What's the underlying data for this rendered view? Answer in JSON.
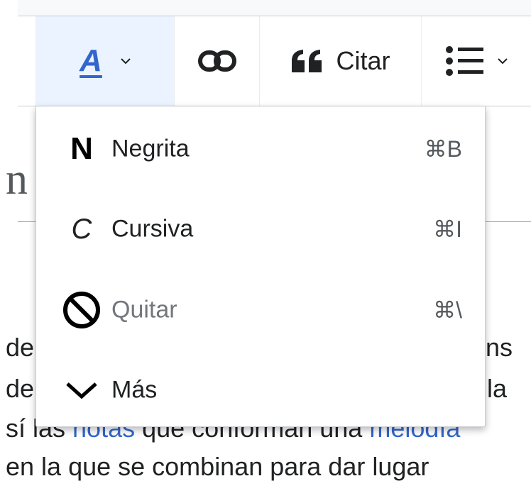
{
  "article": {
    "heading_fragment": "n",
    "line1_left": "de",
    "line1_right": "ans",
    "line2_left": "de",
    "line2_right": "n la",
    "line3_prefix": "sí las ",
    "line3_link1": "notas",
    "line3_mid": " que conforman una ",
    "line3_link2": "melodía",
    "line4": "en la que se combinan para dar lugar"
  },
  "toolbar": {
    "style_glyph": "A",
    "cite_label": "Citar",
    "accent_color": "#3366cc"
  },
  "menu": {
    "items": [
      {
        "label": "Negrita",
        "shortcut": "⌘B",
        "glyph": "N",
        "icon": "bold-icon"
      },
      {
        "label": "Cursiva",
        "shortcut": "⌘I",
        "glyph": "C",
        "icon": "italic-icon"
      },
      {
        "label": "Quitar",
        "shortcut": "⌘\\",
        "icon": "clear-formatting-icon",
        "disabled": true
      },
      {
        "label": "Más",
        "icon": "chevron-down-icon"
      }
    ]
  }
}
